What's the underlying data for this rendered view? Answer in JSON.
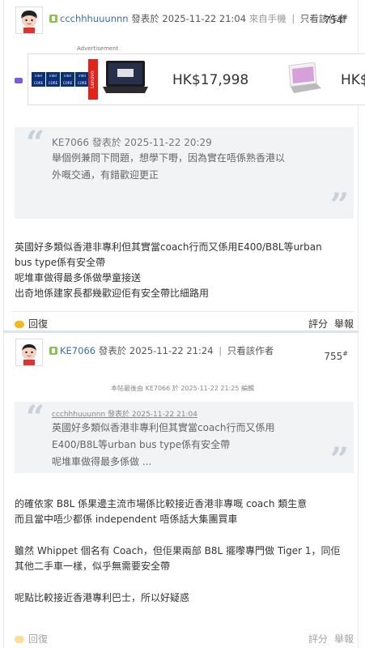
{
  "post1": {
    "author": "ccchhhuuunnn",
    "posted_prefix": "發表於",
    "timestamp": "2025-11-22 21:04",
    "source": "來自手機",
    "view_author_only": "只看該作者",
    "floor": "754",
    "floor_suffix": "#",
    "quote": {
      "author": "KE7066",
      "posted_prefix": "發表於",
      "timestamp": "2025-11-22 20:29",
      "lines": [
        "舉個例兼問下問題，想學下嘢，因為實在唔係熟香港以",
        "外嘅交通，有錯歡迎更正"
      ]
    },
    "body_lines": [
      "英國好多類似香港非專利但其實當coach行而又係用E400/B8L等urban",
      "bus type係有安全帶",
      "呢堆車做得最多係做學童接送",
      "出奇地係建家長都幾歡迎佢有安全帶比細路用"
    ],
    "reply_label": "回復",
    "rate_label": "評分",
    "report_label": "舉報"
  },
  "ad": {
    "label": "Advertisement",
    "brand": "Lenovo",
    "price1": "HK$17,998",
    "price2": "HK$",
    "chip_text": "intel CORE"
  },
  "post2": {
    "author": "KE7066",
    "posted_prefix": "發表於",
    "timestamp": "2025-11-22 21:24",
    "view_author_only": "只看該作者",
    "floor": "755",
    "floor_suffix": "#",
    "edited_note": "本帖最後由 KE7066 於 2025-11-22 21:25 編輯",
    "quote": {
      "header": "ccchhhuuunnn 發表於 2025-11-22 21:04",
      "lines": [
        "英國好多類似香港非專利但其實當coach行而又係用",
        "E400/B8L等urban bus type係有安全帶",
        "呢堆車做得最多係做 ..."
      ]
    },
    "paragraphs": [
      [
        "的確依家 B8L 係果邊主流市場係比較接近香港非專嘅 coach 類生意",
        "而且當中唔少都係 independent 唔係話大集團買車"
      ],
      [
        "雖然 Whippet 個名有 Coach，但佢果兩部 B8L 擺嚟專門做 Tiger 1，同佢",
        "其他二手車一樣，似乎無需要安全帶"
      ],
      [
        "呢點比較接近香港專利巴士，所以好疑惑"
      ]
    ],
    "reply_label": "回復",
    "rate_label": "評分",
    "report_label": "舉報"
  },
  "colors": {
    "accent": "#3a6ea5",
    "quote_bg": "#f2f3f5",
    "reply_icon": "#f5b71f",
    "lenovo": "#e2231a"
  }
}
